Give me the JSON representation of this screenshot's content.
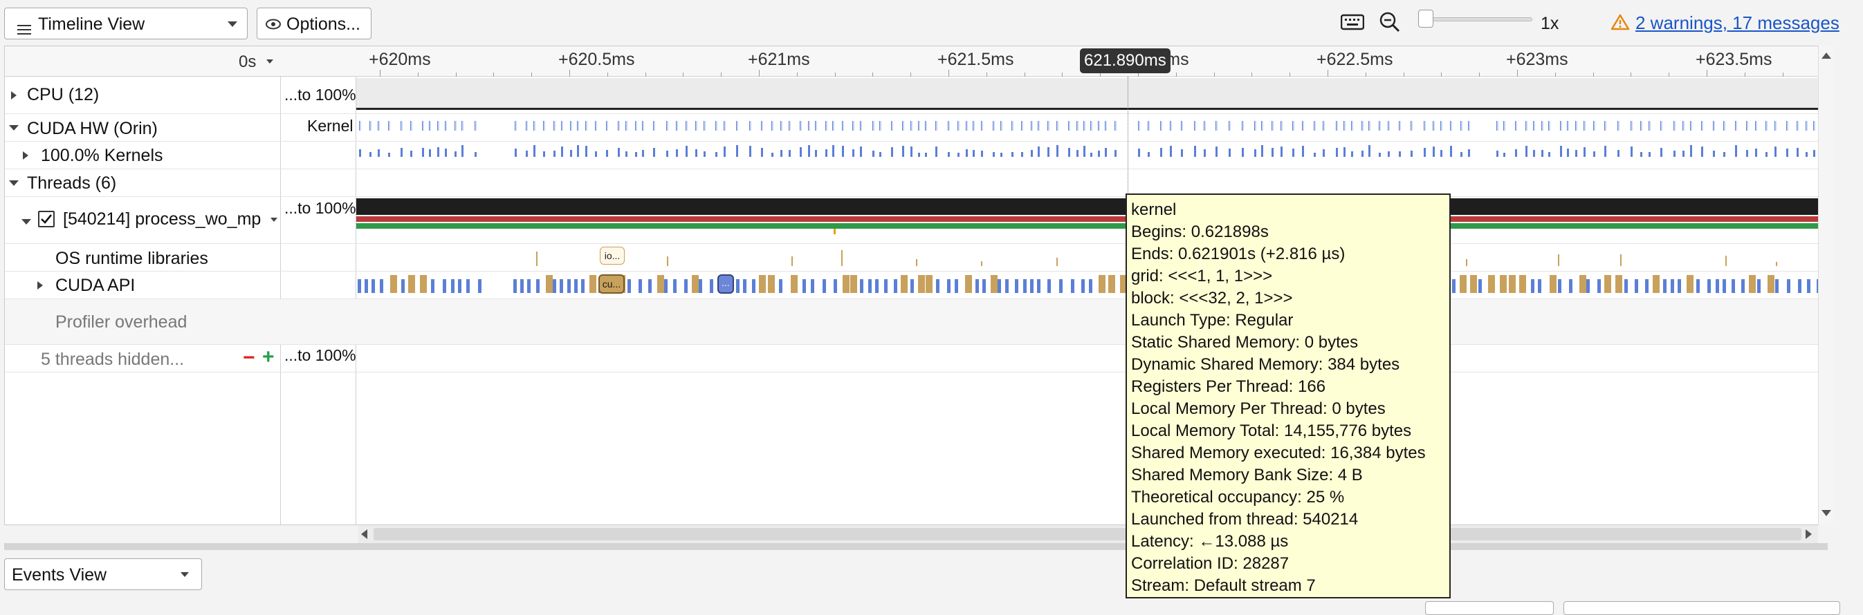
{
  "toolbar": {
    "view_select": "Timeline View",
    "options_label": "Options...",
    "zoom_level": "1x",
    "warnings_link": "2 warnings, 17 messages"
  },
  "timeline": {
    "time_offset": "0s",
    "ticks": [
      "+620ms",
      "+620.5ms",
      "+621ms",
      "+621.5ms",
      "+622ms",
      "+622.5ms",
      "+623ms",
      "+623.5ms"
    ],
    "cursor_time": "621.890ms",
    "rows": {
      "cpu": {
        "label": "CPU (12)",
        "scale": "...to 100%"
      },
      "cuda_hw": {
        "label": "CUDA HW (Orin)",
        "mid": "Kernel"
      },
      "kernels": {
        "label": "100.0% Kernels"
      },
      "threads": {
        "label": "Threads (6)"
      },
      "process": {
        "label": "[540214] process_wo_mp",
        "scale": "...to 100%"
      },
      "os_runtime": {
        "label": "OS runtime libraries"
      },
      "cuda_api": {
        "label": "CUDA API"
      },
      "overhead": {
        "label": "Profiler overhead"
      },
      "hidden": {
        "label": "5 threads hidden...",
        "scale": "...to 100%"
      }
    },
    "chips": {
      "io": "io...",
      "cu": "cu...",
      "dots": "..."
    }
  },
  "tooltip": {
    "title": "kernel",
    "lines": [
      "Begins: 0.621898s",
      "Ends: 0.621901s (+2.816 µs)",
      "grid:  <<<1, 1, 1>>>",
      "block: <<<32, 2, 1>>>",
      "Launch Type: Regular",
      "Static Shared Memory: 0 bytes",
      "Dynamic Shared Memory: 384 bytes",
      "Registers Per Thread: 166",
      "Local Memory Per Thread: 0 bytes",
      "Local Memory Total: 14,155,776 bytes",
      "Shared Memory executed: 16,384 bytes",
      "Shared Memory Bank Size: 4 B",
      "Theoretical occupancy: 25 %",
      "Launched from thread: 540214",
      "Latency: ←13.088 µs",
      "Correlation ID: 28287",
      "Stream: Default stream 7"
    ]
  },
  "bottom": {
    "events_select": "Events View"
  },
  "colors": {
    "kernel_blue": "#5b7fd6",
    "kernel_light": "#c8d6f6",
    "api_tan": "#c8a15c",
    "thread_red": "#b83a3a",
    "thread_green": "#2f9a4a",
    "tooltip_bg": "#ffffd6",
    "link": "#1a55c8",
    "warning": "#e8860c"
  }
}
